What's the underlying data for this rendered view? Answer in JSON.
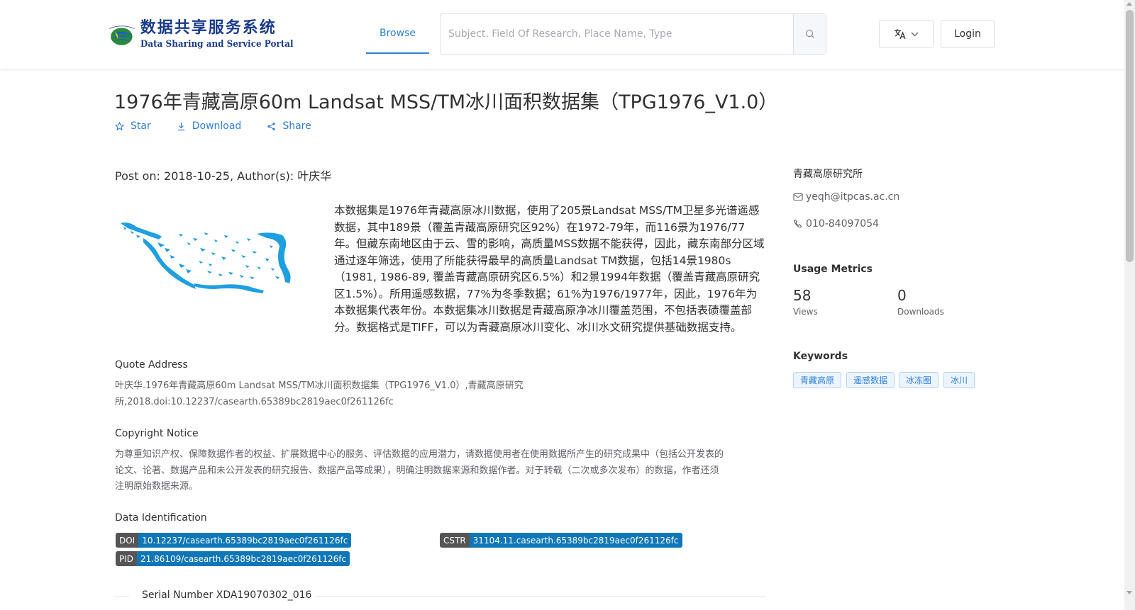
{
  "header": {
    "logo_cn": "数据共享服务系统",
    "logo_en": "Data Sharing and Service Portal",
    "nav_browse": "Browse",
    "search_placeholder": "Subject, Field Of Research, Place Name, Type",
    "login": "Login"
  },
  "dataset": {
    "title": "1976年青藏高原60m Landsat MSS/TM冰川面积数据集（TPG1976_V1.0）",
    "actions": {
      "star": "Star",
      "download": "Download",
      "share": "Share"
    },
    "post_on": "Post on: 2018-10-25, Author(s): 叶庆华",
    "description": "本数据集是1976年青藏高原冰川数据，使用了205景Landsat MSS/TM卫星多光谱遥感数据，其中189景（覆盖青藏高原研究区92%）在1972-79年，而116景为1976/77年。但藏东南地区由于云、雪的影响，高质量MSS数据不能获得，因此，藏东南部分区域通过逐年筛选，使用了所能获得最早的高质量Landsat TM数据，包括14景1980s（1981, 1986-89, 覆盖青藏高原研究区6.5%）和2景1994年数据（覆盖青藏高原研究区1.5%）。所用遥感数据，77%为冬季数据；61%为1976/1977年，因此，1976年为本数据集代表年份。本数据集冰川数据是青藏高原净冰川覆盖范围，不包括表碛覆盖部分。数据格式是TIFF，可以为青藏高原冰川变化、冰川水文研究提供基础数据支持。",
    "quote_head": "Quote Address",
    "quote_line1": "叶庆华.1976年青藏高原60m Landsat MSS/TM冰川面积数据集（TPG1976_V1.0）,青藏高原研究",
    "quote_line2": "所,2018.doi:10.12237/casearth.65389bc2819aec0f261126fc",
    "copyright_head": "Copyright Notice",
    "copyright_line1": "为尊重知识产权、保障数据作者的权益、扩展数据中心的服务、评估数据的应用潜力，请数据使用者在使用数据所产生的研究成果中（包括公开发表的",
    "copyright_line2": "论文、论著、数据产品和未公开发表的研究报告、数据产品等成果），明确注明数据来源和数据作者。对于转载（二次或多次发布）的数据，作者还须",
    "copyright_line3": "注明原始数据来源。",
    "ident_head": "Data Identification",
    "identifiers": [
      {
        "key": "DOI",
        "value": "10.12237/casearth.65389bc2819aec0f261126fc"
      },
      {
        "key": "CSTR",
        "value": "31104.11.casearth.65389bc2819aec0f261126fc"
      },
      {
        "key": "PID",
        "value": "21.86109/casearth.65389bc2819aec0f261126fc"
      }
    ],
    "serial": "Serial Number XDA19070302_016"
  },
  "sidebar": {
    "org": "青藏高原研究所",
    "email": "yeqh@itpcas.ac.cn",
    "phone": "010-84097054",
    "metrics_head": "Usage Metrics",
    "views_value": "58",
    "views_label": "Views",
    "downloads_value": "0",
    "downloads_label": "Downloads",
    "keywords_head": "Keywords",
    "keywords": [
      "青藏高原",
      "遥感数据",
      "冰冻圈",
      "冰川"
    ]
  },
  "colors": {
    "accent": "#2f7fd8",
    "doi_value_bg": "#0f77b7",
    "doi_key_bg": "#555555",
    "glacier": "#1e9fe0"
  }
}
